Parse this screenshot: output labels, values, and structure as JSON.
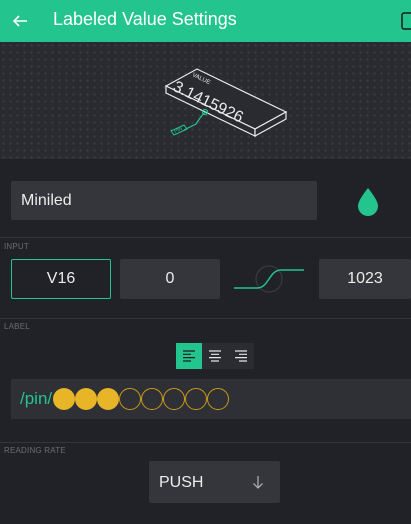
{
  "header": {
    "title": "Labeled Value Settings",
    "back_icon": "arrow-left-icon",
    "background": "#23c48e"
  },
  "preview": {
    "device_label": "VALUE",
    "device_value": "3.1415926",
    "pin_tag": "PIN"
  },
  "name_field": {
    "value": "Miniled",
    "color_icon": "drop-icon",
    "accent_color": "#23c48e"
  },
  "input_section": {
    "label": "INPUT",
    "pin": "V16",
    "min": "0",
    "max": "1023"
  },
  "label_section": {
    "label": "LABEL",
    "alignment_options": [
      "left",
      "center",
      "right"
    ],
    "selected_alignment": "left",
    "label_text": "/pin/",
    "dots_filled": 3,
    "dots_empty": 5,
    "dot_color": "#e7b527"
  },
  "reading_rate": {
    "label": "READING RATE",
    "value": "PUSH",
    "arrow_icon": "arrow-down-icon"
  }
}
